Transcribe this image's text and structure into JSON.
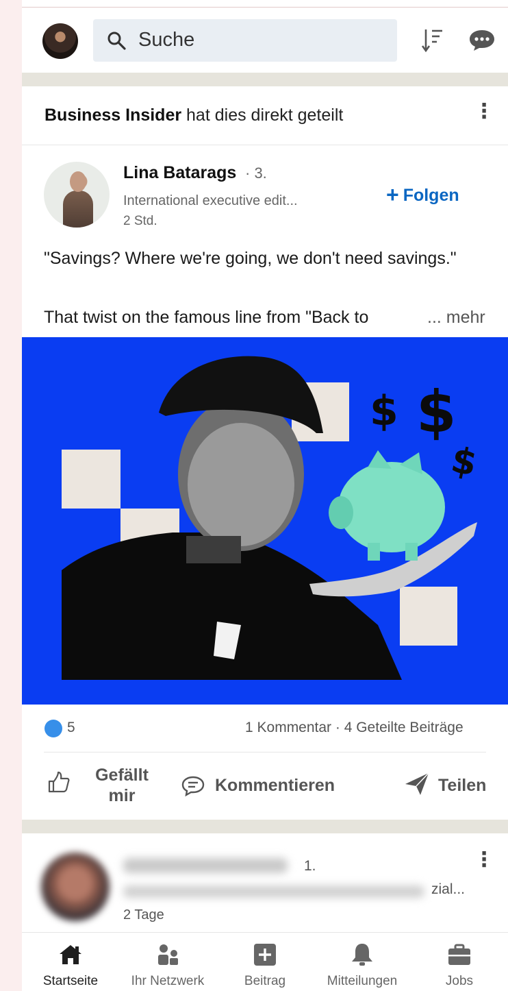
{
  "header": {
    "search_placeholder": "Suche"
  },
  "feed_item": {
    "shared_by": "Business Insider",
    "shared_suffix": "hat dies direkt geteilt",
    "author": {
      "name": "Lina Batarags",
      "degree": "· 3.",
      "title": "International executive edit...",
      "time": "2 Std."
    },
    "follow_label": "Folgen",
    "text_line1": "\"Savings? Where we're going, we don't need savings.\"",
    "text_line2": "That twist on the famous line from \"Back to",
    "more_label": "... mehr",
    "reactions_count": "5",
    "counts_right": "1 Kommentar · 4 Geteilte Beiträge",
    "actions": {
      "like_line1": "Gefällt",
      "like_line2": "mir",
      "comment": "Kommentieren",
      "share": "Teilen"
    }
  },
  "next_item": {
    "degree": "1.",
    "title_tail": "zial...",
    "time": "2 Tage"
  },
  "bottom_nav": {
    "home": "Startseite",
    "network": "Ihr Netzwerk",
    "post": "Beitrag",
    "notifications": "Mitteilungen",
    "jobs": "Jobs"
  },
  "colors": {
    "accent": "#0a66c2",
    "image_background": "#0a3df2",
    "piggy_bank": "#7fe0c4",
    "reaction": "#378fe9"
  }
}
